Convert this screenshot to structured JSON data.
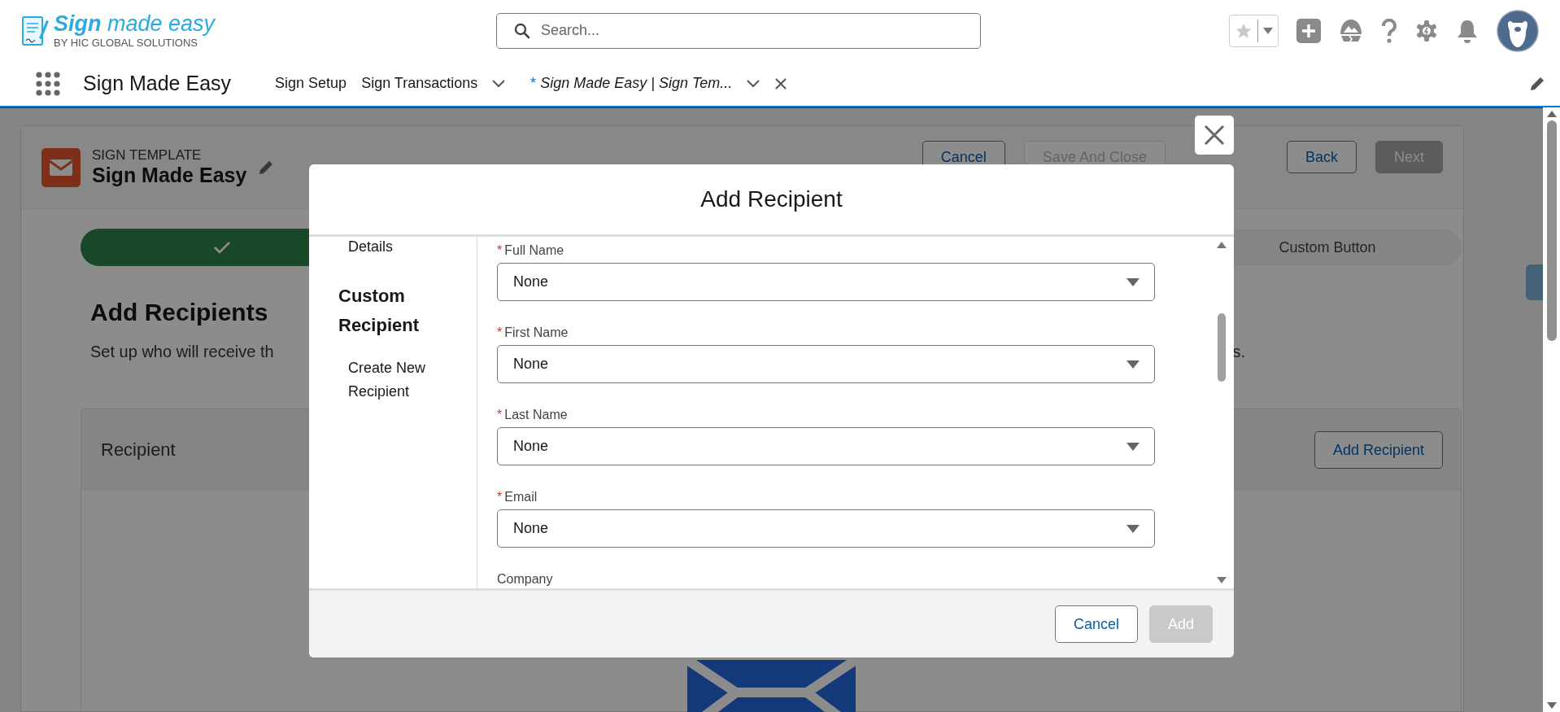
{
  "header": {
    "logo": {
      "title": "**Sign** made easy",
      "subtitle": "BY HIC GLOBAL SOLUTIONS"
    },
    "search": {
      "placeholder": "Search..."
    }
  },
  "nav": {
    "app_name": "Sign Made Easy",
    "items": [
      {
        "label": "Sign Setup",
        "selected": false,
        "has_menu": false,
        "closable": false
      },
      {
        "label": "Sign Transactions",
        "selected": false,
        "has_menu": true,
        "closable": false
      },
      {
        "marker": "*",
        "label": "Sign Made Easy | Sign Tem...",
        "selected": true,
        "has_menu": true,
        "closable": true
      }
    ]
  },
  "record_header": {
    "object": "SIGN TEMPLATE",
    "title": "Sign Made Easy",
    "buttons": [
      {
        "label": "Cancel",
        "disabled": false
      },
      {
        "label": "Save And Close",
        "disabled": true
      },
      {
        "label": "Back",
        "disabled": false
      },
      {
        "label": "Next",
        "disabled": true
      }
    ]
  },
  "path": {
    "steps": [
      {
        "kind": "complete"
      },
      {
        "kind": "incomplete",
        "label": "Custom Button"
      }
    ]
  },
  "section": {
    "heading": "Add Recipients",
    "description_start": "Set up who will receive th",
    "description_end": "s."
  },
  "recipient_card": {
    "title": "Recipient",
    "button": "Add Recipient"
  },
  "modal": {
    "title": "Add Recipient",
    "sidebar": [
      {
        "kind": "item",
        "label": "Details"
      },
      {
        "kind": "heading",
        "label": "Custom Recipient"
      },
      {
        "kind": "item",
        "label": "Create New Recipient"
      }
    ],
    "fields": [
      {
        "label": "Full Name",
        "required": true,
        "value": "None"
      },
      {
        "label": "First Name",
        "required": true,
        "value": "None"
      },
      {
        "label": "Last Name",
        "required": true,
        "value": "None"
      },
      {
        "label": "Email",
        "required": true,
        "value": "None"
      },
      {
        "label": "Company",
        "required": false
      }
    ],
    "buttons": [
      {
        "label": "Cancel",
        "disabled": false
      },
      {
        "label": "Add",
        "disabled": true
      }
    ]
  }
}
